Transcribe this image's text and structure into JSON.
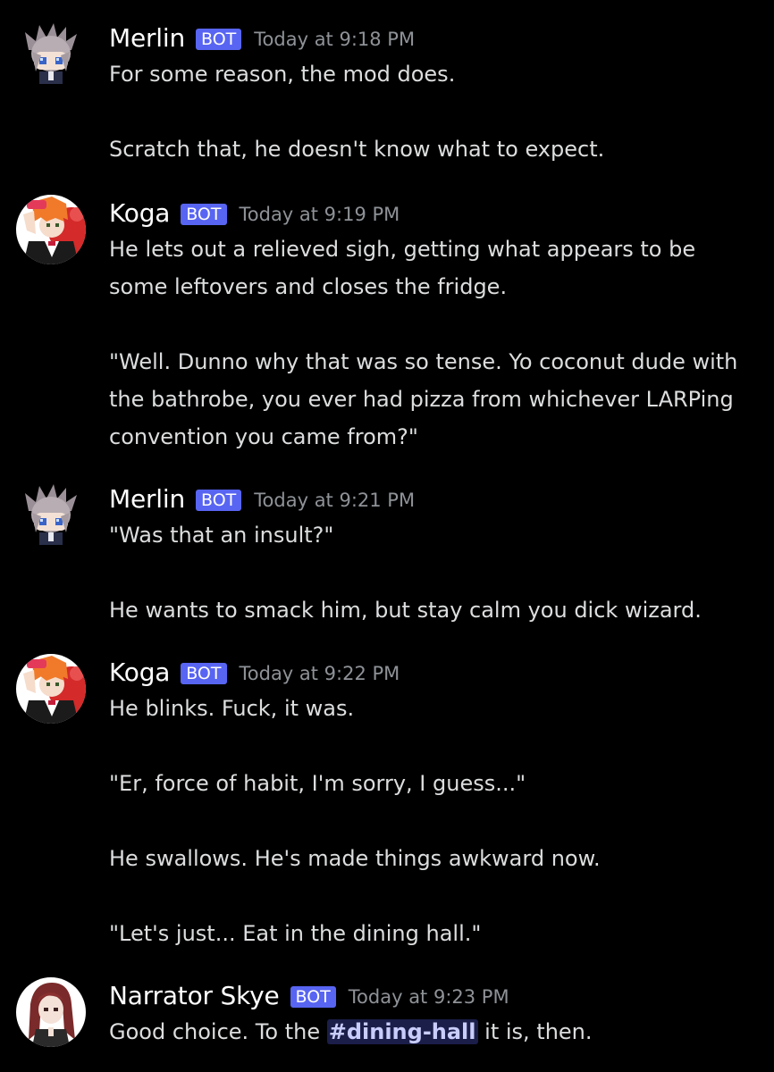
{
  "colors": {
    "background": "#000000",
    "bot_tag": "#5865f2",
    "timestamp": "#8e9297",
    "text": "#dcddde",
    "mention_text": "#c9cdfb"
  },
  "messages": [
    {
      "username": "Merlin",
      "tag": "BOT",
      "timestamp": "Today at 9:18 PM",
      "avatar_icon": "merlin-avatar",
      "lines": [
        "For some reason, the mod does.",
        "",
        "Scratch that, he doesn't know what to expect."
      ]
    },
    {
      "username": "Koga",
      "tag": "BOT",
      "timestamp": "Today at 9:19 PM",
      "avatar_icon": "koga-avatar",
      "lines": [
        "He lets out a relieved sigh, getting what appears to be",
        "some leftovers and closes the fridge.",
        "",
        "\"Well. Dunno why that was so tense. Yo coconut dude with",
        "the bathrobe, you ever had pizza from whichever LARPing",
        "convention you came from?\""
      ]
    },
    {
      "username": "Merlin",
      "tag": "BOT",
      "timestamp": "Today at 9:21 PM",
      "avatar_icon": "merlin-avatar",
      "lines": [
        "\"Was that an insult?\"",
        "",
        "He wants to smack him, but stay calm you dick wizard."
      ]
    },
    {
      "username": "Koga",
      "tag": "BOT",
      "timestamp": "Today at 9:22 PM",
      "avatar_icon": "koga-avatar",
      "lines": [
        "He blinks. Fuck, it was.",
        "",
        "\"Er, force of habit, I'm sorry, I guess...\"",
        "",
        "He swallows. He's made things awkward now.",
        "",
        "\"Let's just... Eat in the dining hall.\""
      ]
    },
    {
      "username": "Narrator Skye",
      "tag": "BOT",
      "timestamp": "Today at 9:23 PM",
      "avatar_icon": "narrator-avatar",
      "final_line": {
        "before": "Good choice. To the ",
        "mention": "#dining-hall",
        "after": " it is, then."
      }
    }
  ]
}
